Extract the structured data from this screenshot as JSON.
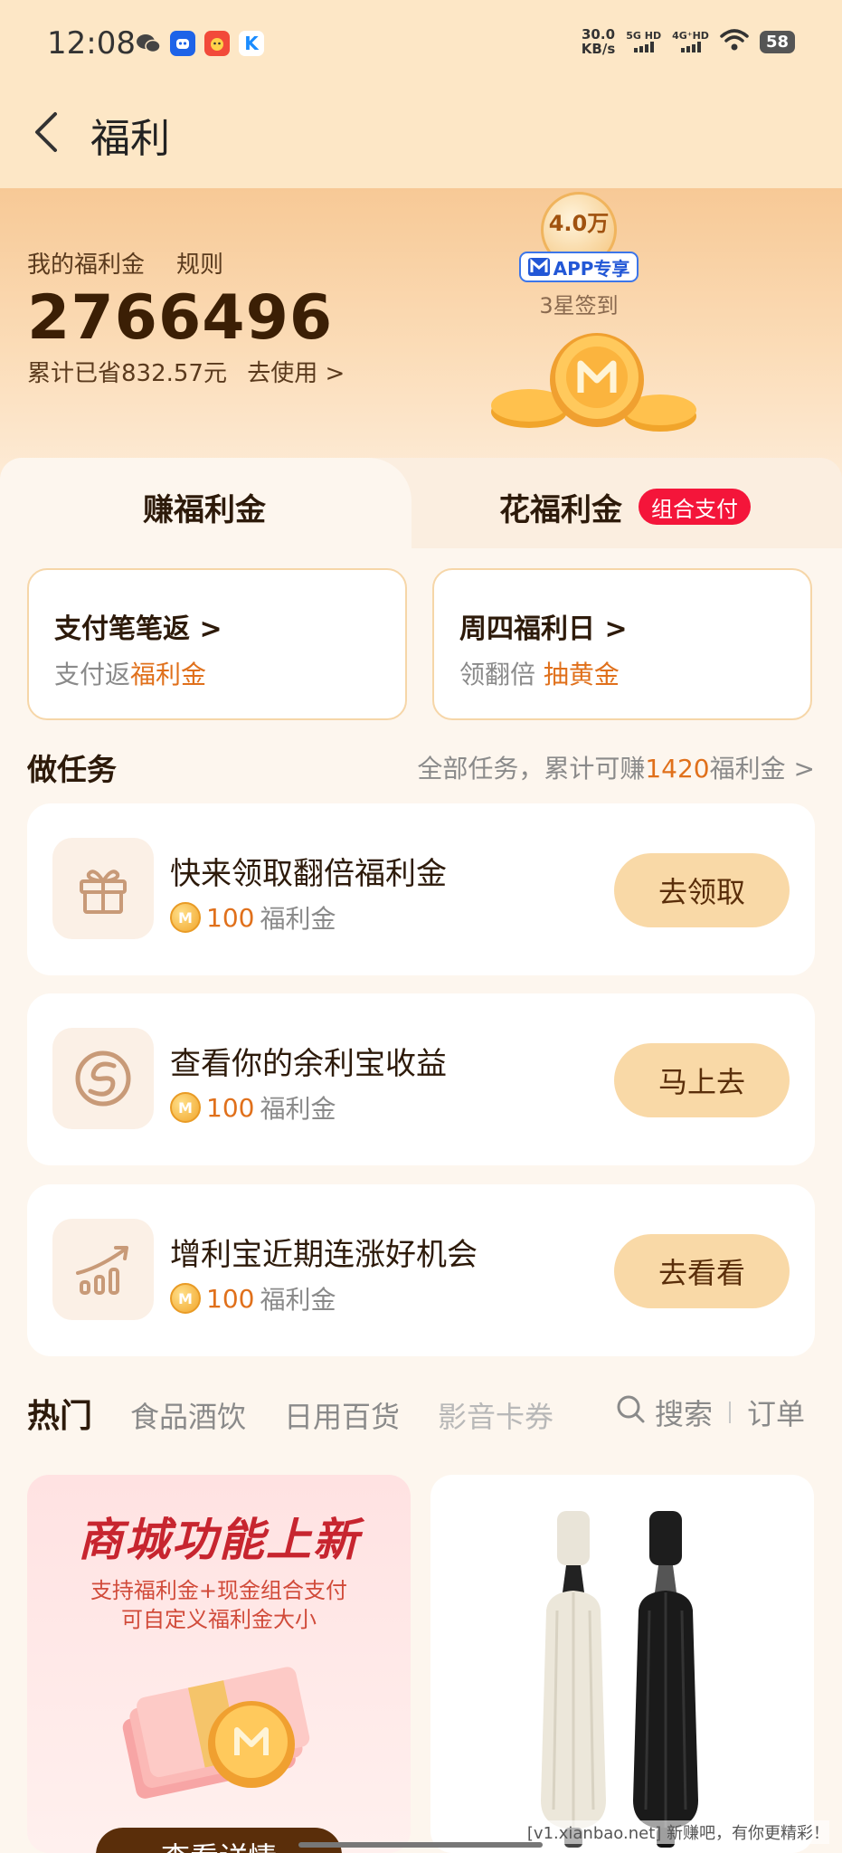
{
  "status_bar": {
    "time": "12:08",
    "net_speed_value": "30.0",
    "net_speed_unit": "KB/s",
    "sim1": "5G HD",
    "sim2": "4G⁺HD",
    "battery": "58"
  },
  "header": {
    "title": "福利"
  },
  "hero": {
    "label": "我的福利金",
    "rules_link": "规则",
    "balance": "2766496",
    "saved_text": "累计已省832.57元",
    "use_link": "去使用 >",
    "badge_amount": "4.0万",
    "badge_tag": "APP专享",
    "badge_caption": "3星签到"
  },
  "tabs": {
    "earn": "赚福利金",
    "spend": "花福利金",
    "spend_badge": "组合支付"
  },
  "promos": [
    {
      "title": "支付笔笔返 >",
      "sub_plain": "支付返",
      "sub_highlight": "福利金"
    },
    {
      "title": "周四福利日 >",
      "sub_plain": "领翻倍 ",
      "sub_highlight": "抽黄金"
    }
  ],
  "tasks_section": {
    "title": "做任务",
    "link_prefix": "全部任务，累计可赚",
    "link_amount": "1420",
    "link_suffix": "福利金 >"
  },
  "tasks": [
    {
      "title": "快来领取翻倍福利金",
      "reward": "100",
      "unit": "福利金",
      "button": "去领取",
      "icon": "gift-icon"
    },
    {
      "title": "查看你的余利宝收益",
      "reward": "100",
      "unit": "福利金",
      "button": "马上去",
      "icon": "yulibao-icon"
    },
    {
      "title": "增利宝近期连涨好机会",
      "reward": "100",
      "unit": "福利金",
      "button": "去看看",
      "icon": "growth-chart-icon"
    }
  ],
  "categories": [
    "热门",
    "食品酒饮",
    "日用百货",
    "影音卡券"
  ],
  "search_label": "搜索",
  "orders_label": "订单",
  "product_left": {
    "title": "商城功能上新",
    "sub1": "支持福利金+现金组合支付",
    "sub2": "可自定义福利金大小",
    "button": "查看详情"
  },
  "watermark": "[v1.xianbao.net] 新赚吧，有你更精彩！",
  "colors": {
    "accent": "#e0701b",
    "button_bg": "#f9d9a7",
    "badge_red": "#f4153a"
  }
}
